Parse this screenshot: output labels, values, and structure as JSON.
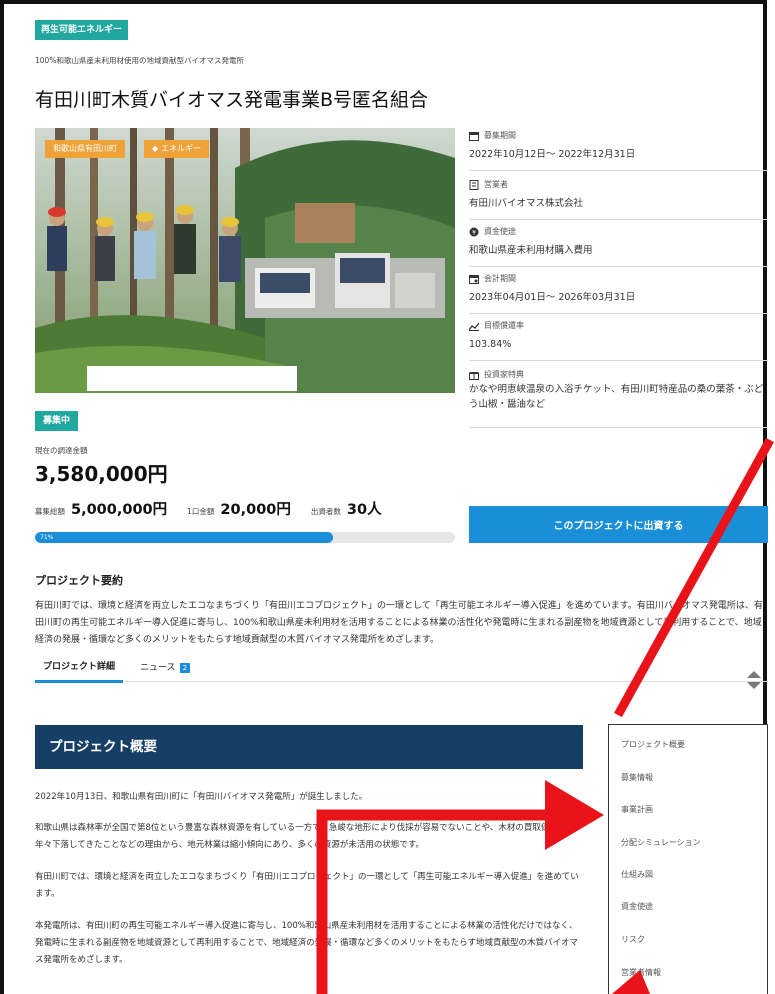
{
  "category_tag": "再生可能エネルギー",
  "subtitle": "100%和歌山県産未利用材使用の地域貢献型バイオマス発電所",
  "title": "有田川町木質バイオマス発電事業B号匿名組合",
  "photo_tags": [
    "和歌山県有田川町",
    "エネルギー"
  ],
  "status_badge": "募集中",
  "current": {
    "label": "現在の調達金額",
    "value": "3,580,000円"
  },
  "stats": [
    {
      "label": "募集総額",
      "value": "5,000,000円"
    },
    {
      "label": "1口金額",
      "value": "20,000円"
    },
    {
      "label": "出資者数",
      "value": "30人"
    }
  ],
  "progress": {
    "label": "71%",
    "fraction": 0.71
  },
  "invest_button": "このプロジェクトに出資する",
  "meta": [
    {
      "icon": "calendar-icon",
      "label": "募集期間",
      "value": "2022年10月12日～ 2022年12月31日"
    },
    {
      "icon": "building-icon",
      "label": "営業者",
      "value": "有田川バイオマス株式会社"
    },
    {
      "icon": "coin-icon",
      "label": "資金使途",
      "value": "和歌山県産未利用材購入費用"
    },
    {
      "icon": "calendar-range-icon",
      "label": "会計期間",
      "value": "2023年04月01日～ 2026年03月31日"
    },
    {
      "icon": "chart-line-icon",
      "label": "目標償還率",
      "value": "103.84%"
    },
    {
      "icon": "gift-icon",
      "label": "投資家特典",
      "value": "かなや明恵峡温泉の入浴チケット、有田川町特産品の桑の葉茶・ぶどう山椒・醤油など"
    }
  ],
  "summary": {
    "heading": "プロジェクト要約",
    "text": "有田川町では、環境と経済を両立したエコなまちづくり「有田川エコプロジェクト」の一環として「再生可能エネルギー導入促進」を進めています。有田川バイオマス発電所は、有田川町の再生可能エネルギー導入促進に寄与し、100%和歌山県産未利用材を活用することによる林業の活性化や発電時に生まれる副産物を地域資源として再利用することで、地域経済の発展・循環など多くのメリットをもたらす地域貢献型の木質バイオマス発電所をめざします。"
  },
  "tabs": [
    {
      "label": "プロジェクト詳細",
      "badge": ""
    },
    {
      "label": "ニュース",
      "badge": "2"
    }
  ],
  "overview": {
    "heading": "プロジェクト概要",
    "paragraphs": [
      "2022年10月13日、和歌山県有田川町に「有田川バイオマス発電所」が誕生しました。",
      "和歌山県は森林率が全国で第8位という豊富な森林資源を有している一方で、急峻な地形により伐採が容易でないことや、木材の買取価格が年々下落してきたことなどの理由から、地元林業は縮小傾向にあり、多くの資源が未活用の状態です。",
      "有田川町では、環境と経済を両立したエコなまちづくり「有田川エコプロジェクト」の一環として「再生可能エネルギー導入促進」を進めています。",
      "本発電所は、有田川町の再生可能エネルギー導入促進に寄与し、100%和歌山県産未利用材を活用することによる林業の活性化だけではなく、発電時に生まれる副産物を地域資源として再利用することで、地域経済の発展・循環など多くのメリットをもたらす地域貢献型の木質バイオマス発電所をめざします。"
    ]
  },
  "side_nav": [
    "プロジェクト概要",
    "募集情報",
    "事業計画",
    "分配シミュレーション",
    "仕組み図",
    "資金使途",
    "リスク",
    "営業者情報"
  ],
  "colors": {
    "teal": "#1fa7a0",
    "blue": "#1a8fd8",
    "navy": "#173f66",
    "orange": "#f0a23a",
    "arrow_red": "#e8141a"
  }
}
